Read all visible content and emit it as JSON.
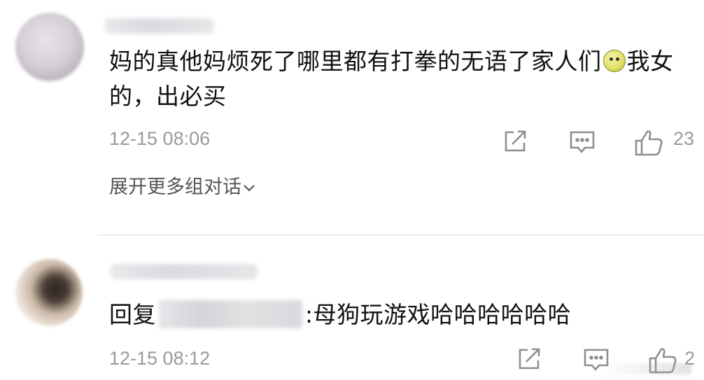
{
  "comments": [
    {
      "text_part1": "妈的真他妈烦死了哪里都有打拳的无语了家人们",
      "emoji_name": "speechless-emoji",
      "text_part2": "我女的，出必买",
      "timestamp": "12-15 08:06",
      "like_count": "23",
      "expand_label": "展开更多组对话"
    },
    {
      "reply_prefix": "回复",
      "reply_text": ":母狗玩游戏哈哈哈哈哈哈",
      "timestamp": "12-15 08:12",
      "like_count": "2"
    }
  ],
  "icons": {
    "share": "share-icon",
    "comment": "comment-icon",
    "like": "thumbs-up-icon",
    "expand": "chevron-down-icon"
  },
  "colors": {
    "text": "#111111",
    "meta": "#9a9a9a",
    "link": "#555555"
  }
}
